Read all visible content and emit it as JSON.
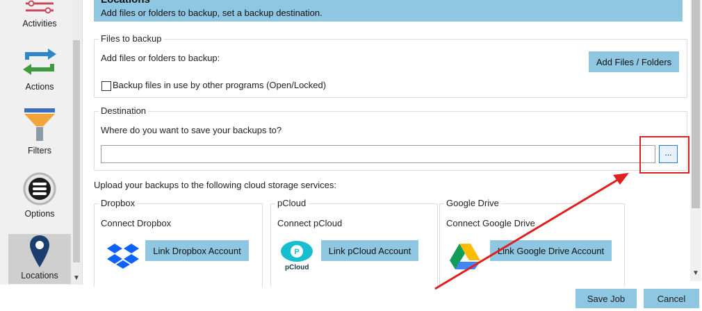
{
  "sidebar": {
    "items": [
      {
        "label": "Activities",
        "icon": "activities-sliders-icon"
      },
      {
        "label": "Actions",
        "icon": "sync-arrows-icon"
      },
      {
        "label": "Filters",
        "icon": "funnel-icon"
      },
      {
        "label": "Options",
        "icon": "options-stack-icon"
      },
      {
        "label": "Locations",
        "icon": "location-pin-icon"
      }
    ],
    "selected": "Locations"
  },
  "header": {
    "title": "Locations",
    "subtitle": "Add files or folders to backup, set a backup destination."
  },
  "files_group": {
    "title": "Files to backup",
    "prompt": "Add files or folders to backup:",
    "add_button": "Add Files / Folders",
    "checkbox_label": "Backup files in use by other programs (Open/Locked)",
    "checkbox_checked": false
  },
  "destination_group": {
    "title": "Destination",
    "prompt": "Where do you want to save your backups to?",
    "path_value": "",
    "browse_button": "..."
  },
  "cloud": {
    "intro": "Upload your backups to the following cloud storage services:",
    "services": [
      {
        "title": "Dropbox",
        "connect_text": "Connect Dropbox",
        "button": "Link Dropbox Account",
        "logo": "dropbox-logo-icon"
      },
      {
        "title": "pCloud",
        "connect_text": "Connect pCloud",
        "button": "Link pCloud Account",
        "logo": "pcloud-logo-icon",
        "logo_text": "pCloud"
      },
      {
        "title": "Google Drive",
        "connect_text": "Connect Google Drive",
        "button": "Link Google Drive Account",
        "logo": "google-drive-logo-icon"
      }
    ]
  },
  "footer": {
    "save_button": "Save Job",
    "cancel_button": "Cancel"
  },
  "colors": {
    "accent": "#8fc6e2",
    "annotation": "#e02020"
  }
}
